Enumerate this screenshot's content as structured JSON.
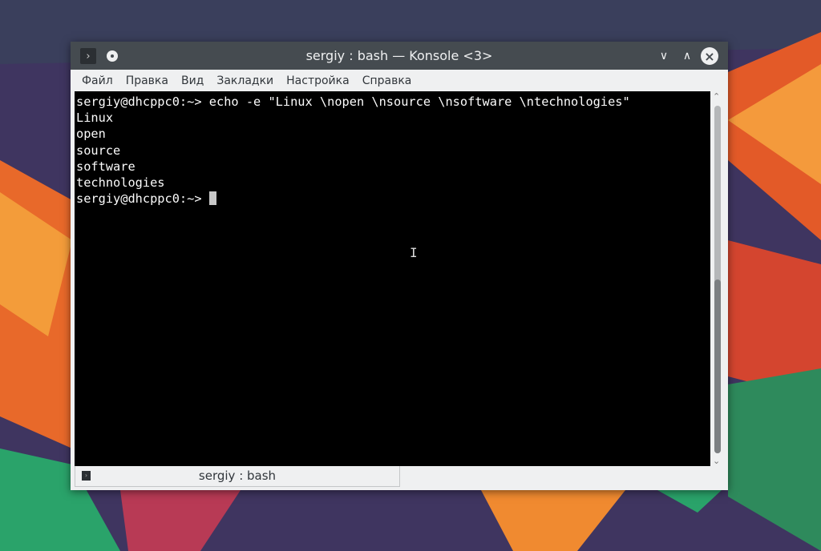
{
  "window": {
    "title": "sergiy : bash — Konsole <3>"
  },
  "menu": [
    "Файл",
    "Правка",
    "Вид",
    "Закладки",
    "Настройка",
    "Справка"
  ],
  "terminal": {
    "lines": [
      "sergiy@dhcppc0:~> echo -e \"Linux \\nopen \\nsource \\nsoftware \\ntechnologies\"",
      "Linux",
      "open",
      "source",
      "software",
      "technologies"
    ],
    "prompt": "sergiy@dhcppc0:~> "
  },
  "scrollbar": {
    "position_fraction": 1.0,
    "visible_fraction": 0.5
  },
  "tab": {
    "label": "sergiy : bash"
  }
}
